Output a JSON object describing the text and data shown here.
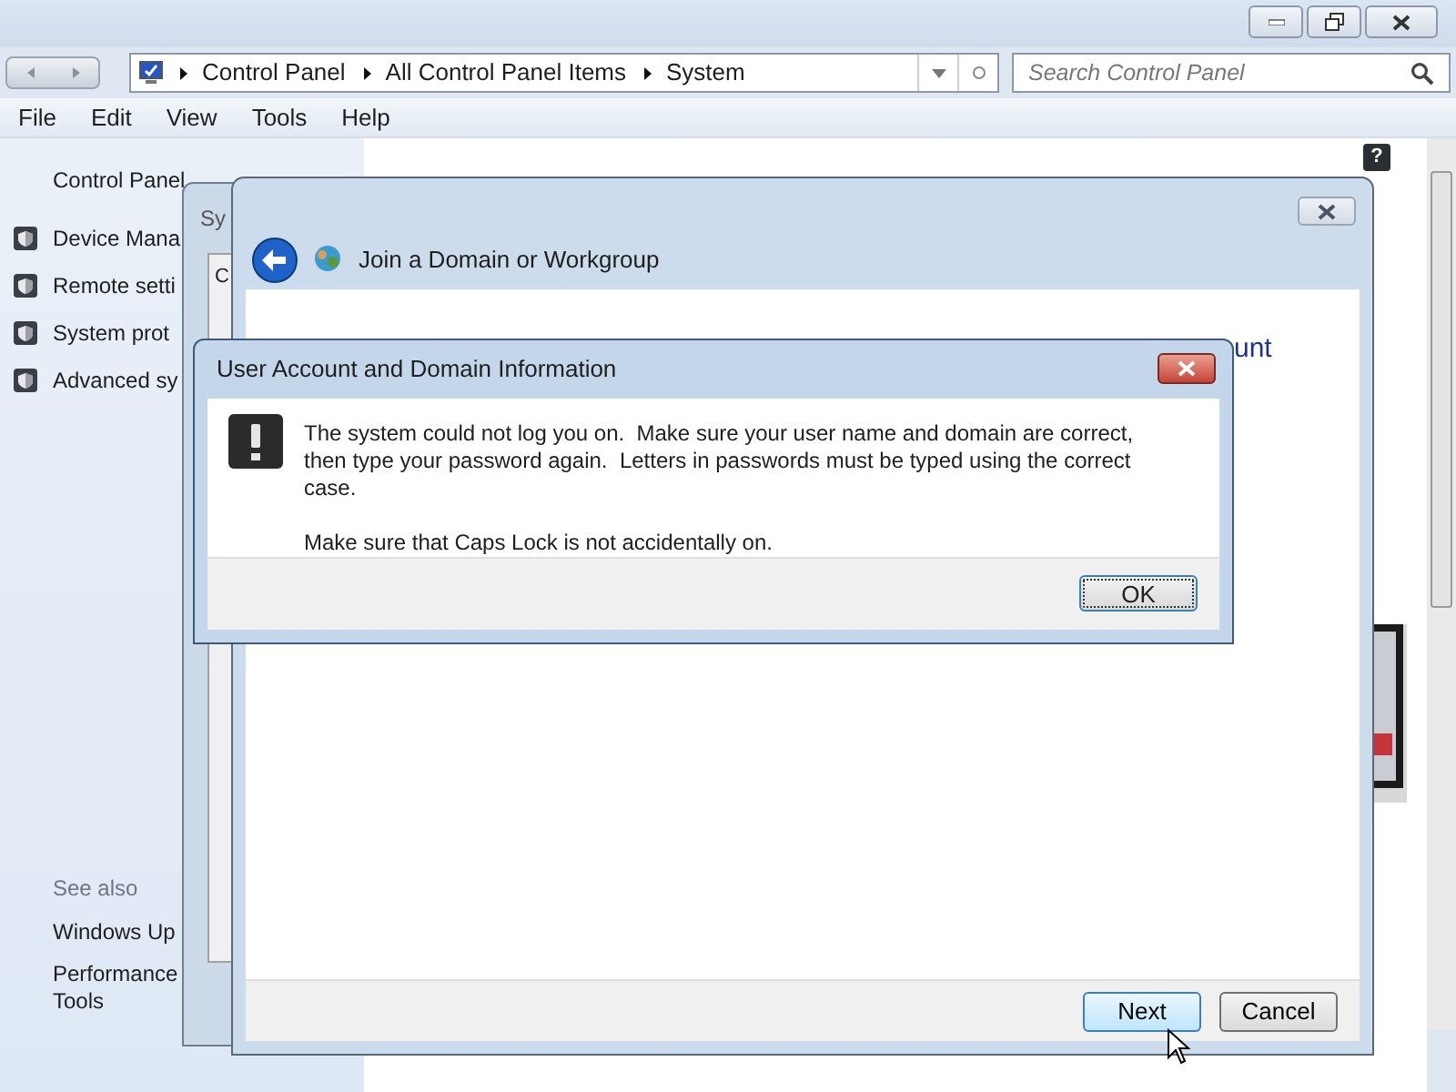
{
  "explorer": {
    "breadcrumbs": [
      "Control Panel",
      "All Control Panel Items",
      "System"
    ],
    "search": {
      "placeholder": "Search Control Panel"
    },
    "menu": [
      "File",
      "Edit",
      "View",
      "Tools",
      "Help"
    ],
    "sidebar": {
      "home": "Control Panel",
      "tasks": [
        "Device Mana",
        "Remote setti",
        "System prot",
        "Advanced sy"
      ],
      "see_also_heading": "See also",
      "see_also": [
        "Windows Up",
        "Performance\nTools"
      ]
    },
    "help_button": "?"
  },
  "system_properties": {
    "title": "Sy",
    "tab": "C"
  },
  "wizard": {
    "title": "Join a Domain or Workgroup",
    "heading_fragment": "unt",
    "buttons": [
      {
        "label": "Next",
        "default": true
      },
      {
        "label": "Cancel",
        "default": false
      }
    ]
  },
  "error_dialog": {
    "title": "User Account and Domain Information",
    "message": "The system could not log you on.  Make sure your user name and domain are correct, then type your password again.  Letters in passwords must be typed using the correct case.",
    "note": "Make sure that Caps Lock is not accidentally on.",
    "button": "OK"
  }
}
